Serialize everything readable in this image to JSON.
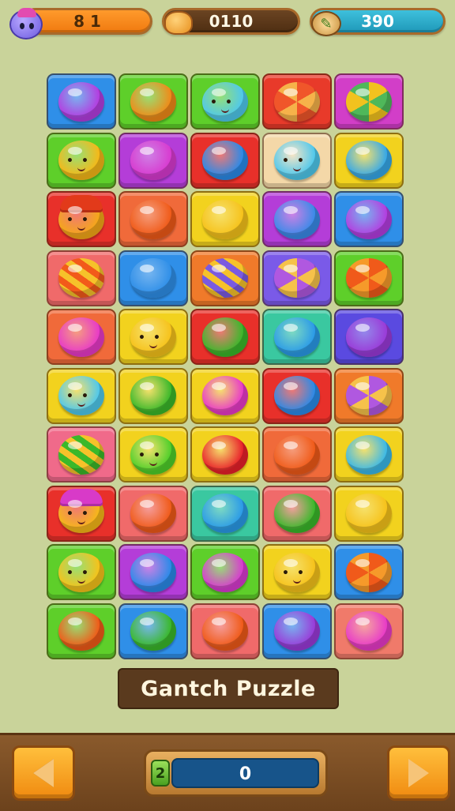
{
  "hud": {
    "lives": {
      "text": "8 1",
      "icon": "blob-avatar-icon"
    },
    "coins": {
      "value": "0110",
      "icon": "coin-bag-icon"
    },
    "score": {
      "value": "390",
      "icon": "paintbrush-icon"
    }
  },
  "board": {
    "columns": 5,
    "rows": 10,
    "tiles": [
      {
        "bg": "#2f8fe8",
        "candy": "#b43de0",
        "style": "plain"
      },
      {
        "bg": "#5ecf2a",
        "candy": "#f08a18",
        "style": "plain"
      },
      {
        "bg": "#5ecf2a",
        "candy": "#4fc8ec",
        "style": "face"
      },
      {
        "bg": "#e83a2a",
        "candy": "#f0562a",
        "style": "swirl",
        "c2": "#f6b24a"
      },
      {
        "bg": "#d23ec8",
        "candy": "#f2c21e",
        "style": "swirl",
        "c2": "#4fb85a"
      },
      {
        "bg": "#5ecf2a",
        "candy": "#f6b818",
        "style": "face"
      },
      {
        "bg": "#b43dd8",
        "candy": "#d83ad0",
        "style": "plain"
      },
      {
        "bg": "#e8302a",
        "candy": "#2a8ae8",
        "style": "plain"
      },
      {
        "bg": "#f4d8a8",
        "candy": "#4fc8ec",
        "style": "face"
      },
      {
        "bg": "#f2d21e",
        "candy": "#36a8e8",
        "style": "plain"
      },
      {
        "bg": "#e8302a",
        "candy": "#f4a818",
        "style": "hat",
        "hat": "#e23a1a"
      },
      {
        "bg": "#f06a3a",
        "candy": "#f05a18",
        "style": "plain"
      },
      {
        "bg": "#f2d21e",
        "candy": "#f6c21a",
        "style": "plain"
      },
      {
        "bg": "#b43dd8",
        "candy": "#3a8ae8",
        "style": "plain"
      },
      {
        "bg": "#2f8fe8",
        "candy": "#b43de0",
        "style": "plain"
      },
      {
        "bg": "#f06a6a",
        "candy": "#f25a1a",
        "style": "striped",
        "c2": "#f6c22a"
      },
      {
        "bg": "#2f8fe8",
        "candy": "#2f8fe8",
        "style": "plain"
      },
      {
        "bg": "#f07a2a",
        "candy": "#7a5ae0",
        "style": "striped",
        "c2": "#f6c22a"
      },
      {
        "bg": "#7a5ae8",
        "candy": "#b058e0",
        "style": "swirl",
        "c2": "#f6c24a"
      },
      {
        "bg": "#5ecf2a",
        "candy": "#f05a1a",
        "style": "swirl",
        "c2": "#f69a2a"
      },
      {
        "bg": "#f06a3a",
        "candy": "#e83ac8",
        "style": "plain"
      },
      {
        "bg": "#f2d21e",
        "candy": "#f6c21a",
        "style": "face"
      },
      {
        "bg": "#e8302a",
        "candy": "#3ab82a",
        "style": "plain"
      },
      {
        "bg": "#3ac8a0",
        "candy": "#2a9ae8",
        "style": "plain"
      },
      {
        "bg": "#5a4ae0",
        "candy": "#9a3ad8",
        "style": "plain"
      },
      {
        "bg": "#f2d21e",
        "candy": "#4fc8ec",
        "style": "face"
      },
      {
        "bg": "#f2d21e",
        "candy": "#3ab82a",
        "style": "plain"
      },
      {
        "bg": "#f2d21e",
        "candy": "#e83ac8",
        "style": "plain"
      },
      {
        "bg": "#e8302a",
        "candy": "#2a8ae8",
        "style": "plain"
      },
      {
        "bg": "#f07a2a",
        "candy": "#b058e0",
        "style": "swirl",
        "c2": "#f6c24a"
      },
      {
        "bg": "#f06a8a",
        "candy": "#3ab82a",
        "style": "striped",
        "c2": "#f6c22a"
      },
      {
        "bg": "#f2d21e",
        "candy": "#4fcf2a",
        "style": "face"
      },
      {
        "bg": "#f2d21e",
        "candy": "#e8202a",
        "style": "plain"
      },
      {
        "bg": "#f06a3a",
        "candy": "#f05a18",
        "style": "plain"
      },
      {
        "bg": "#f2d21e",
        "candy": "#3ab8e8",
        "style": "plain"
      },
      {
        "bg": "#e8302a",
        "candy": "#f6b818",
        "style": "hat",
        "hat": "#d83ac8"
      },
      {
        "bg": "#f06a6a",
        "candy": "#f05a18",
        "style": "plain"
      },
      {
        "bg": "#3ac8a0",
        "candy": "#2a9ae8",
        "style": "plain"
      },
      {
        "bg": "#f06a6a",
        "candy": "#3ab82a",
        "style": "plain"
      },
      {
        "bg": "#f2d21e",
        "candy": "#f6c21a",
        "style": "plain"
      },
      {
        "bg": "#5ecf2a",
        "candy": "#f6c21a",
        "style": "face"
      },
      {
        "bg": "#b43dd8",
        "candy": "#2a8ae8",
        "style": "plain"
      },
      {
        "bg": "#5ecf2a",
        "candy": "#d83ad0",
        "style": "plain"
      },
      {
        "bg": "#f2d21e",
        "candy": "#f6c21a",
        "style": "face"
      },
      {
        "bg": "#2f8fe8",
        "candy": "#f05a1a",
        "style": "swirl",
        "c2": "#f69a2a"
      },
      {
        "bg": "#5ecf2a",
        "candy": "#f05a18",
        "style": "plain"
      },
      {
        "bg": "#2f8fe8",
        "candy": "#3ab82a",
        "style": "plain"
      },
      {
        "bg": "#f06a6a",
        "candy": "#f05a18",
        "style": "plain"
      },
      {
        "bg": "#2f8fe8",
        "candy": "#9a3ad8",
        "style": "plain"
      },
      {
        "bg": "#f07a6a",
        "candy": "#e83ac8",
        "style": "plain"
      }
    ]
  },
  "title": "Gantch Puzzle",
  "footer": {
    "prev_icon": "arrow-left-icon",
    "next_icon": "arrow-right-icon",
    "level": "2",
    "progress_value": "0",
    "progress_fraction": 0.0
  }
}
